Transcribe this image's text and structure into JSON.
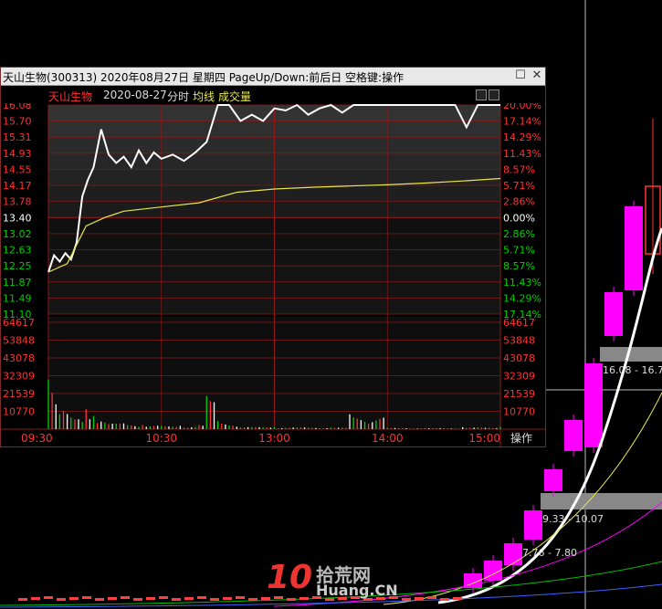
{
  "window": {
    "title": "天山生物(300313) 2020年08月27日 星期四 PageUp/Down:前后日 空格键:操作",
    "minimize_icon": "square-icon",
    "close_icon": "close-icon"
  },
  "header": {
    "stock_name": "天山生物",
    "date": "2020-08-27",
    "mode": "分时",
    "avg_line_label": "均线",
    "volume_label": "成交量"
  },
  "colors": {
    "up": "#ff3232",
    "down": "#00d000",
    "neutral": "#ffffff",
    "price_line": "#ffffff",
    "avg_line": "#e8e84a",
    "grid": "#8b1a1a",
    "candle_up": "#ff00ff"
  },
  "price_axis": {
    "left": [
      "16.08",
      "15.70",
      "15.31",
      "14.93",
      "14.55",
      "14.17",
      "13.78",
      "13.40",
      "13.02",
      "12.63",
      "12.25",
      "11.87",
      "11.49",
      "11.10"
    ],
    "right": [
      "20.00%",
      "17.14%",
      "14.29%",
      "11.43%",
      "8.57%",
      "5.71%",
      "2.86%",
      "0.00%",
      "2.86%",
      "5.71%",
      "8.57%",
      "11.43%",
      "14.29%",
      "17.14%"
    ]
  },
  "volume_axis": [
    "64617",
    "53848",
    "43078",
    "32309",
    "21539",
    "10770"
  ],
  "time_axis": [
    "09:30",
    "10:30",
    "13:00",
    "14:00",
    "15:00"
  ],
  "op_button": "操作",
  "background": {
    "range_labels": [
      "16.08 - 16.7",
      "9.33 - 10.07",
      "7.76 - 7.80"
    ]
  },
  "watermark": {
    "logo_number": "10",
    "site_name_cn": "拾荒网",
    "site_url": "Huang.CN"
  },
  "chart_data": {
    "type": "line",
    "series": [
      {
        "name": "分时",
        "time_index": [
          0,
          3,
          6,
          9,
          12,
          15,
          18,
          21,
          24,
          28,
          32,
          36,
          40,
          44,
          48,
          52,
          56,
          60,
          66,
          72,
          78,
          84,
          90,
          96,
          102,
          108,
          114,
          120,
          126,
          132,
          138,
          144,
          150,
          156,
          162,
          168,
          174,
          180,
          186,
          192,
          198,
          204,
          210,
          216,
          222,
          228,
          234,
          240
        ],
        "values": [
          12.1,
          12.5,
          12.35,
          12.55,
          12.4,
          12.8,
          13.9,
          14.3,
          14.6,
          15.5,
          14.9,
          14.7,
          14.85,
          14.6,
          15.0,
          14.7,
          14.95,
          14.8,
          14.9,
          14.75,
          14.95,
          15.2,
          16.08,
          16.08,
          15.7,
          15.85,
          15.7,
          16.0,
          15.95,
          16.08,
          15.85,
          16.0,
          16.08,
          15.9,
          16.08,
          16.08,
          16.08,
          16.08,
          16.08,
          16.08,
          16.08,
          16.08,
          16.08,
          16.08,
          15.55,
          16.08,
          16.08,
          16.08
        ]
      },
      {
        "name": "均线",
        "time_index": [
          0,
          10,
          20,
          30,
          40,
          60,
          80,
          100,
          120,
          140,
          160,
          180,
          200,
          220,
          240
        ],
        "values": [
          12.1,
          12.3,
          13.2,
          13.4,
          13.55,
          13.65,
          13.75,
          14.0,
          14.08,
          14.12,
          14.15,
          14.18,
          14.22,
          14.27,
          14.33
        ]
      }
    ],
    "volume": {
      "time_index": [
        0,
        2,
        4,
        6,
        8,
        12,
        16,
        20,
        24,
        30,
        40,
        50,
        60,
        70,
        80,
        84,
        90,
        100,
        120,
        150,
        160,
        180,
        200,
        210,
        220,
        230,
        240
      ],
      "values": [
        30000,
        22000,
        15000,
        9000,
        11000,
        7000,
        6000,
        12000,
        8000,
        4000,
        3500,
        2500,
        2000,
        2000,
        2500,
        20000,
        5000,
        1500,
        1200,
        1000,
        9000,
        800,
        700,
        600,
        1200,
        900,
        1500
      ]
    },
    "prev_close": 13.4,
    "ylim": [
      11.1,
      16.08
    ],
    "volume_max": 64617,
    "time_range": [
      0,
      240
    ],
    "grid": true
  }
}
